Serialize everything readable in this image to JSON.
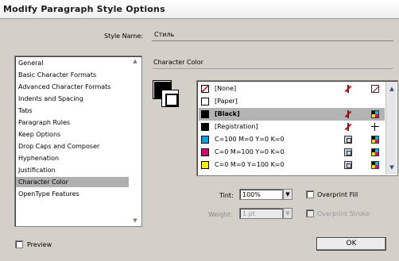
{
  "window": {
    "title": "Modify Paragraph Style Options"
  },
  "style_name": {
    "label": "Style Name:",
    "value": "Стиль"
  },
  "section_title": "Character Color",
  "categories": [
    "General",
    "Basic Character Formats",
    "Advanced Character Formats",
    "Indents and Spacing",
    "Tabs",
    "Paragraph Rules",
    "Keep Options",
    "Drop Caps and Composer",
    "Hyphenation",
    "Justification",
    "Character Color",
    "OpenType Features"
  ],
  "selected_category": "Character Color",
  "swatches": [
    {
      "name": "[None]",
      "color": "none",
      "icon1": "no-print-icon",
      "icon2": "none-swatch-icon"
    },
    {
      "name": "[Paper]",
      "color": "#ffffff",
      "icon1": "",
      "icon2": ""
    },
    {
      "name": "[Black]",
      "color": "#000000",
      "icon1": "no-edit-icon",
      "icon2": "cmyk-icon",
      "selected": true
    },
    {
      "name": "[Registration]",
      "color": "#000000",
      "icon1": "no-edit-icon",
      "icon2": "registration-icon"
    },
    {
      "name": "C=100 M=0 Y=0 K=0",
      "color": "#00a0e6",
      "icon1": "process-icon",
      "icon2": "cmyk-icon"
    },
    {
      "name": "C=0 M=100 Y=0 K=0",
      "color": "#d8006e",
      "icon1": "process-icon",
      "icon2": "cmyk-icon"
    },
    {
      "name": "C=0 M=0 Y=100 K=0",
      "color": "#fff200",
      "icon1": "process-icon",
      "icon2": "cmyk-icon"
    }
  ],
  "tint": {
    "label": "Tint:",
    "value": "100%"
  },
  "weight": {
    "label": "Weight:",
    "value": "1 pt"
  },
  "overprint_fill": {
    "label": "Overprint Fill",
    "checked": false
  },
  "overprint_stroke": {
    "label": "Overprint Stroke",
    "checked": false
  },
  "preview": {
    "label": "Preview",
    "checked": false
  },
  "ok_button": "OK"
}
